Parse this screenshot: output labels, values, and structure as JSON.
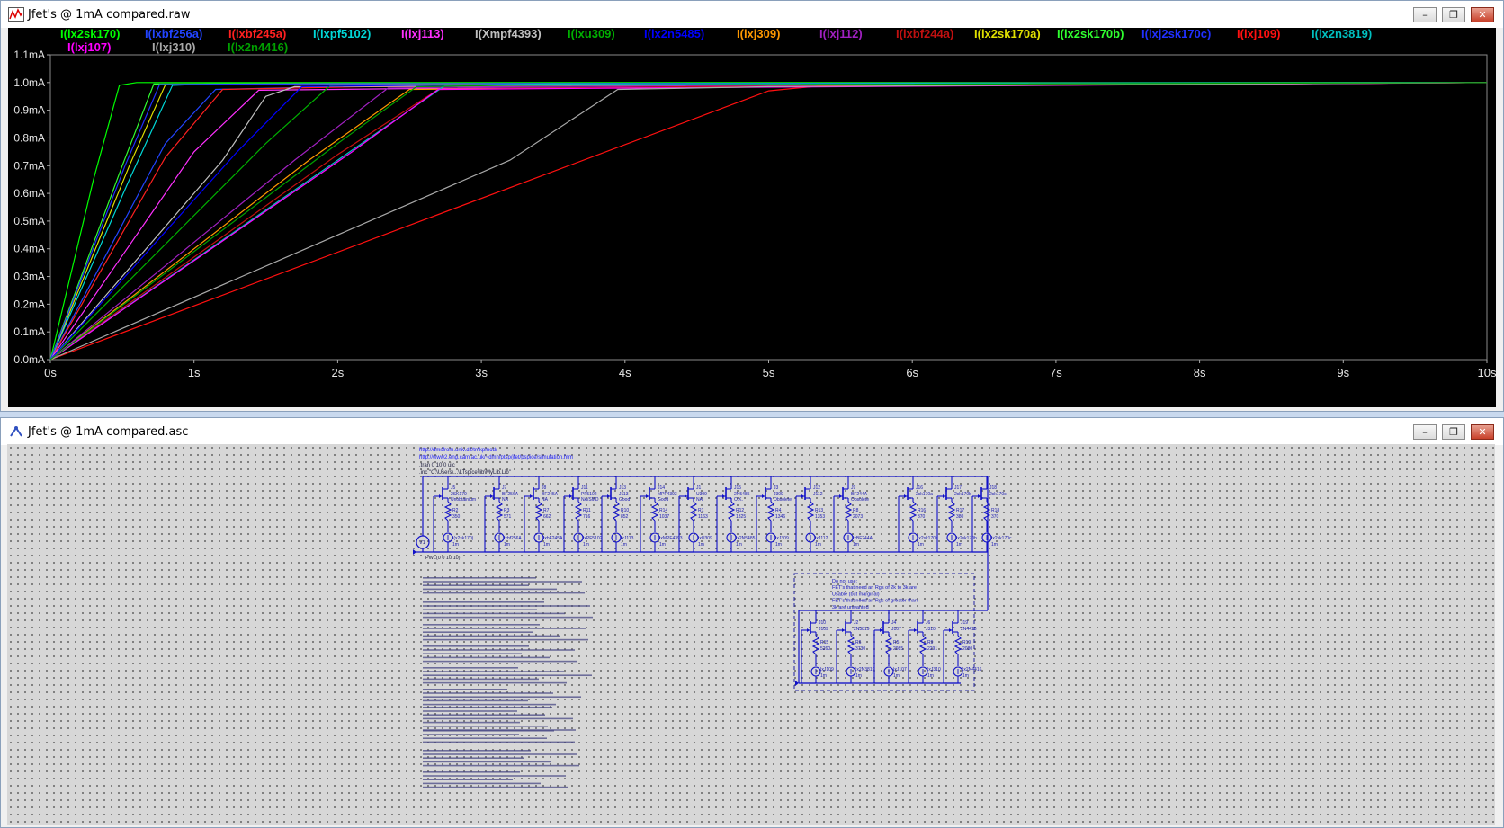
{
  "waveform_window": {
    "title": "Jfet's @ 1mA compared.raw",
    "buttons": [
      "minimize",
      "restore",
      "close"
    ]
  },
  "schematic_window": {
    "title": "Jfet's @ 1mA compared.asc",
    "buttons": [
      "minimize",
      "restore",
      "close"
    ],
    "header_lines": [
      "http://dmsfrom.univ.dz/tmkpmod/",
      "http://www2.eng.cam.ac.uk/~dmh/ptsp/jfet/pspice/simulation.htm",
      ".tran 0 10 0 uic",
      ".inc \"C:\\Users\\...\\LTspice\\lib\\MyLib.Lib\""
    ],
    "source_label": "V1",
    "source_spec": "PWL(0 0 10 10)",
    "note_lines": [
      "Do not use:",
      "FET's that need an Rgs of 2k to 3k are",
      "Usable (but marginal)",
      "FET's that need an Rgs of greater than",
      "3k are unwanted"
    ],
    "top_row_parts": [
      {
        "ref": "J5",
        "model": "2SK170",
        "rating": "Unobtainium",
        "rref": "R2",
        "rval": "350",
        "lbl": "I(x2sk170)"
      },
      {
        "ref": "J7",
        "model": "BF256A",
        "rating": "NA",
        "rref": "R3",
        "rval": "571",
        "lbl": "Ixbf256A"
      },
      {
        "ref": "J8",
        "model": "BF245A",
        "rating": "NA",
        "rref": "R7",
        "rval": "662",
        "lbl": "IxbF245A"
      },
      {
        "ref": "J11",
        "model": "PF5102",
        "rating": "NA/SMD",
        "rref": "R11",
        "rval": "716",
        "lbl": "IxPF5102"
      },
      {
        "ref": "J13",
        "model": "J113",
        "rating": "Good",
        "rref": "R10",
        "rval": "852",
        "lbl": "IxJ113"
      },
      {
        "ref": "J14",
        "model": "MPF4393",
        "rating": "Good",
        "rref": "R14",
        "rval": "1037",
        "lbl": "IxMPF4393"
      },
      {
        "ref": "J1",
        "model": "U309",
        "rating": "NA",
        "rref": "R1",
        "rval": "1163",
        "lbl": "IxU309"
      },
      {
        "ref": "J15",
        "model": "2N5485",
        "rating": "O.K.",
        "rref": "R12",
        "rval": "1325",
        "lbl": "Ix2N5485"
      },
      {
        "ref": "J3",
        "model": "J309",
        "rating": "Obsolete",
        "rref": "R4",
        "rval": "1346",
        "lbl": "IxJ309"
      },
      {
        "ref": "J12",
        "model": "J112",
        "rating": "",
        "rref": "R13",
        "rval": "1353",
        "lbl": "IxJ112"
      },
      {
        "ref": "J9",
        "model": "BF244A",
        "rating": "Obsolete",
        "rref": "R8",
        "rval": "2073",
        "lbl": "IxBF244A"
      },
      {
        "ref": "J16",
        "model": "2sk170a",
        "rating": "",
        "rref": "R16",
        "rval": "370",
        "lbl": "Ix2sk170a"
      },
      {
        "ref": "J17",
        "model": "2sk170b",
        "rating": "",
        "rref": "R17",
        "rval": "380",
        "lbl": "Ix2sk170b"
      },
      {
        "ref": "J18",
        "model": "2sk170c",
        "rating": "",
        "rref": "R18",
        "rval": "370",
        "lbl": "Ix2sk170c"
      }
    ],
    "bottom_row_parts": [
      {
        "ref": "J10",
        "model": "J109",
        "rref": "R15",
        "rval": "5260",
        "lbl": "IxJ109"
      },
      {
        "ref": "J2",
        "model": "2N3819",
        "rref": "R6",
        "rval": "3730",
        "lbl": "Ix2N3819"
      },
      {
        "ref": "J4",
        "model": "J107",
        "rref": "R5",
        "rval": "2985",
        "lbl": "IxJ107"
      },
      {
        "ref": "J6",
        "model": "J310",
        "rref": "R9",
        "rval": "2291",
        "lbl": "IxJ310"
      },
      {
        "ref": "J19",
        "model": "2N4416",
        "rref": "R19",
        "rval": "2080",
        "lbl": "Ix2N4416"
      }
    ]
  },
  "chart_data": {
    "type": "line",
    "xlabel": "",
    "ylabel": "",
    "xlim": [
      0,
      10
    ],
    "ylim": [
      0,
      1.1
    ],
    "x_ticks": [
      "0s",
      "1s",
      "2s",
      "3s",
      "4s",
      "5s",
      "6s",
      "7s",
      "8s",
      "9s",
      "10s"
    ],
    "y_ticks": [
      "0.0mA",
      "0.1mA",
      "0.2mA",
      "0.3mA",
      "0.4mA",
      "0.5mA",
      "0.6mA",
      "0.7mA",
      "0.8mA",
      "0.9mA",
      "1.0mA",
      "1.1mA"
    ],
    "background": "#000000",
    "legend_position": "top",
    "series": [
      {
        "name": "I(lx2sk170)",
        "color": "#00ff00",
        "points": [
          [
            0,
            0
          ],
          [
            0.3,
            0.65
          ],
          [
            0.48,
            0.99
          ],
          [
            0.6,
            1.0
          ],
          [
            10,
            1.0
          ]
        ]
      },
      {
        "name": "I(lxbf256a)",
        "color": "#2244ff",
        "points": [
          [
            0,
            0
          ],
          [
            0.8,
            0.78
          ],
          [
            1.15,
            0.975
          ],
          [
            2,
            0.985
          ],
          [
            10,
            1.0
          ]
        ]
      },
      {
        "name": "I(lxbf245a)",
        "color": "#ff2020",
        "points": [
          [
            0,
            0
          ],
          [
            0.8,
            0.73
          ],
          [
            1.2,
            0.975
          ],
          [
            2.2,
            0.985
          ],
          [
            10,
            1.0
          ]
        ]
      },
      {
        "name": "I(lxpf5102)",
        "color": "#00d8d8",
        "points": [
          [
            0,
            0
          ],
          [
            0.55,
            0.65
          ],
          [
            0.85,
            0.99
          ],
          [
            1.1,
            0.995
          ],
          [
            10,
            1.0
          ]
        ]
      },
      {
        "name": "I(lxj113)",
        "color": "#ff30ff",
        "points": [
          [
            0,
            0
          ],
          [
            1.0,
            0.75
          ],
          [
            1.45,
            0.972
          ],
          [
            2.5,
            0.978
          ],
          [
            10,
            1.0
          ]
        ]
      },
      {
        "name": "I(Xmpf4393)",
        "color": "#c0c0c0",
        "points": [
          [
            0,
            0
          ],
          [
            1.2,
            0.72
          ],
          [
            1.5,
            0.95
          ],
          [
            1.7,
            0.985
          ],
          [
            10,
            1.0
          ]
        ]
      },
      {
        "name": "I(lxu309)",
        "color": "#00b000",
        "points": [
          [
            0,
            0
          ],
          [
            1.5,
            0.78
          ],
          [
            1.95,
            0.99
          ],
          [
            2.5,
            0.995
          ],
          [
            10,
            1.0
          ]
        ]
      },
      {
        "name": "I(lx2n5485)",
        "color": "#0000ff",
        "points": [
          [
            0,
            0
          ],
          [
            1.3,
            0.75
          ],
          [
            1.75,
            0.985
          ],
          [
            2.5,
            0.99
          ],
          [
            10,
            1.0
          ]
        ]
      },
      {
        "name": "I(lxj309)",
        "color": "#ff9900",
        "points": [
          [
            0,
            0
          ],
          [
            1.8,
            0.72
          ],
          [
            2.5,
            0.975
          ],
          [
            3.5,
            0.98
          ],
          [
            10,
            1.0
          ]
        ]
      },
      {
        "name": "I(lxj112)",
        "color": "#a020c0",
        "points": [
          [
            0,
            0
          ],
          [
            1.7,
            0.72
          ],
          [
            2.35,
            0.98
          ],
          [
            3.2,
            0.985
          ],
          [
            10,
            1.0
          ]
        ]
      },
      {
        "name": "I(lxbf244a)",
        "color": "#c01010",
        "points": [
          [
            0,
            0
          ],
          [
            2.0,
            0.74
          ],
          [
            2.7,
            0.975
          ],
          [
            4.5,
            0.985
          ],
          [
            10,
            1.0
          ]
        ]
      },
      {
        "name": "I(lx2sk170a)",
        "color": "#e0e000",
        "points": [
          [
            0,
            0
          ],
          [
            0.55,
            0.7
          ],
          [
            0.8,
            0.992
          ],
          [
            2,
            0.995
          ],
          [
            10,
            1.0
          ]
        ]
      },
      {
        "name": "I(lx2sk170b)",
        "color": "#30ff30",
        "points": [
          [
            0,
            0
          ],
          [
            0.5,
            0.7
          ],
          [
            0.72,
            0.995
          ],
          [
            2,
            0.997
          ],
          [
            10,
            1.0
          ]
        ]
      },
      {
        "name": "I(lxj2sk170c)",
        "color": "#2030ff",
        "points": [
          [
            0,
            0
          ],
          [
            0.52,
            0.7
          ],
          [
            0.76,
            0.993
          ],
          [
            2,
            0.996
          ],
          [
            10,
            1.0
          ]
        ]
      },
      {
        "name": "I(lxj109)",
        "color": "#ff1010",
        "points": [
          [
            0,
            0
          ],
          [
            5.0,
            0.97
          ],
          [
            5.4,
            0.99
          ],
          [
            6.5,
            0.995
          ],
          [
            10,
            1.0
          ]
        ]
      },
      {
        "name": "I(lx2n3819)",
        "color": "#00c0c0",
        "points": [
          [
            0,
            0
          ],
          [
            2.0,
            0.72
          ],
          [
            2.75,
            0.99
          ],
          [
            3.5,
            0.995
          ],
          [
            10,
            1.0
          ]
        ]
      },
      {
        "name": "I(lxj107)",
        "color": "#ff00ff",
        "points": [
          [
            0,
            0
          ],
          [
            2.1,
            0.75
          ],
          [
            2.7,
            0.975
          ],
          [
            4,
            0.98
          ],
          [
            10,
            1.0
          ]
        ]
      },
      {
        "name": "I(lxj310)",
        "color": "#a8a8a8",
        "points": [
          [
            0,
            0
          ],
          [
            3.2,
            0.72
          ],
          [
            3.95,
            0.975
          ],
          [
            5,
            0.985
          ],
          [
            10,
            1.0
          ]
        ]
      },
      {
        "name": "I(lx2n4416)",
        "color": "#00a000",
        "points": [
          [
            0,
            0
          ],
          [
            2.0,
            0.78
          ],
          [
            2.55,
            0.985
          ],
          [
            3.2,
            0.99
          ],
          [
            10,
            1.0
          ]
        ]
      }
    ]
  }
}
